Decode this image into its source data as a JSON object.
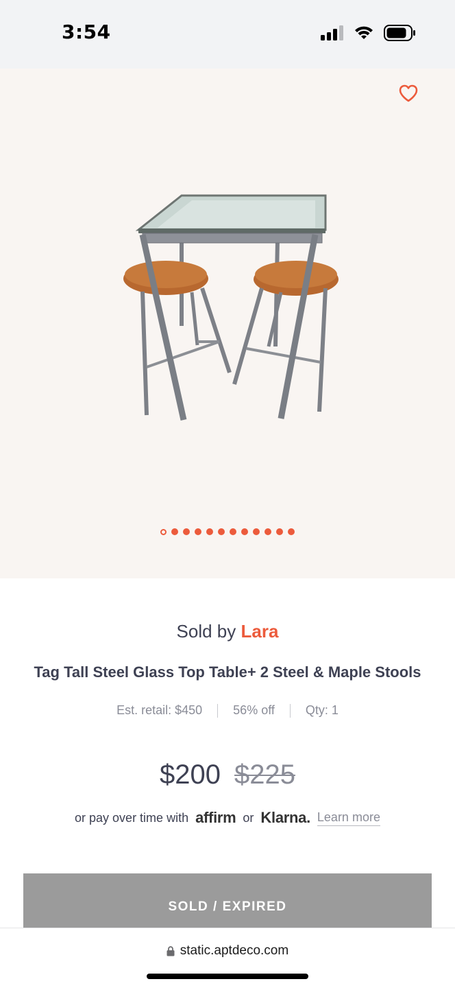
{
  "status_bar": {
    "time": "3:54",
    "icons": [
      "cellular-signal-icon",
      "wifi-icon",
      "battery-icon"
    ]
  },
  "gallery": {
    "favorite_icon": "heart-outline-icon",
    "image_alt": "table-with-two-stools",
    "total_images": 12,
    "active_index": 0
  },
  "product": {
    "sold_by_prefix": "Sold by",
    "seller": "Lara",
    "title": "Tag Tall Steel Glass Top Table+ 2 Steel & Maple Stools",
    "est_retail": "Est. retail: $450",
    "discount": "56% off",
    "qty": "Qty: 1",
    "price": "$200",
    "original_price": "$225",
    "finance_prefix": "or pay over time with",
    "affirm": "affirm",
    "or": "or",
    "klarna": "Klarna.",
    "learn_more": "Learn more"
  },
  "cta": {
    "label": "SOLD / EXPIRED"
  },
  "browser": {
    "url": "static.aptdeco.com",
    "lock_icon": "lock-icon"
  },
  "colors": {
    "accent": "#ec5b3c",
    "text": "#3e4153",
    "muted": "#8a8c97",
    "gallery_bg": "#f9f5f2",
    "sold_button": "#9b9b9b"
  }
}
